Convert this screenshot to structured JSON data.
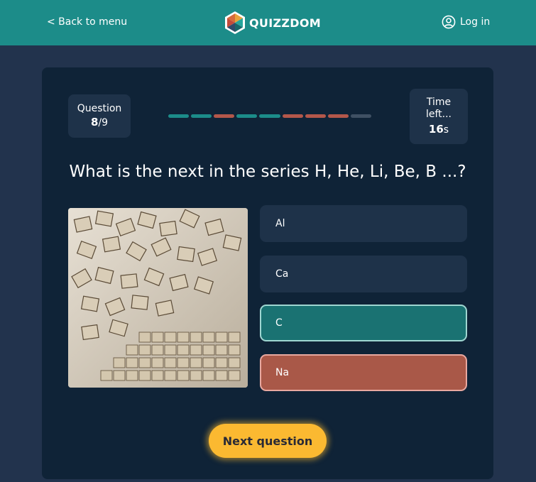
{
  "nav": {
    "back_label": "< Back to menu",
    "logo_text": "QUIZZDOM",
    "login_label": "Log in"
  },
  "quiz": {
    "question_label": "Question",
    "question_current": "8",
    "question_total": "/9",
    "progress": [
      "correct",
      "correct",
      "wrong",
      "correct",
      "correct",
      "wrong",
      "wrong",
      "wrong",
      "pending"
    ],
    "time_label": "Time left...",
    "time_value": "16",
    "time_unit": "s",
    "question_text": "What is the next in the series H, He, Li, Be, B ...?",
    "answers": [
      {
        "label": "Al",
        "state": "default"
      },
      {
        "label": "Ca",
        "state": "default"
      },
      {
        "label": "C",
        "state": "correct"
      },
      {
        "label": "Na",
        "state": "wrong"
      }
    ],
    "next_label": "Next question"
  },
  "colors": {
    "topbar": "#1c8c89",
    "correct": "#1a7272",
    "wrong": "#a95848",
    "accent": "#fbb931",
    "progress_correct": "#1c8c89",
    "progress_wrong": "#b3574a",
    "progress_pending": "#3f5063"
  },
  "icons": {
    "logo": "hexagon-logo-icon",
    "login": "user-circle-icon"
  }
}
